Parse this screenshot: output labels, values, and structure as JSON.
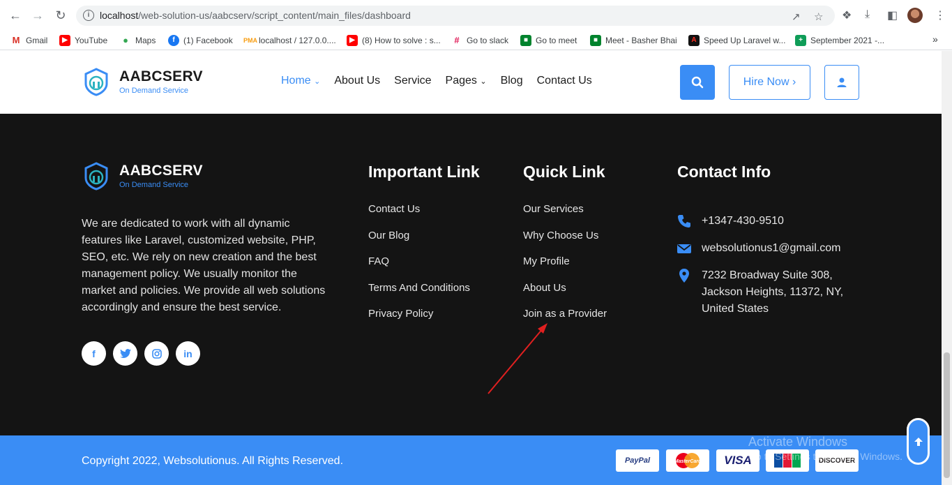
{
  "browser": {
    "url_host": "localhost",
    "url_path": "/web-solution-us/aabcserv/script_content/main_files/dashboard",
    "bookmarks": [
      {
        "label": "Gmail",
        "icon": "gmail-icon"
      },
      {
        "label": "YouTube",
        "icon": "youtube-icon"
      },
      {
        "label": "Maps",
        "icon": "maps-icon"
      },
      {
        "label": "(1) Facebook",
        "icon": "facebook-icon"
      },
      {
        "label": "localhost / 127.0.0....",
        "icon": "phpmyadmin-icon"
      },
      {
        "label": "(8) How to solve : s...",
        "icon": "youtube-icon"
      },
      {
        "label": "Go to slack",
        "icon": "slack-icon"
      },
      {
        "label": "Go to meet",
        "icon": "meet-icon"
      },
      {
        "label": "Meet - Basher Bhai",
        "icon": "meet-icon"
      },
      {
        "label": "Speed Up Laravel w...",
        "icon": "laravel-icon"
      },
      {
        "label": "September 2021 -...",
        "icon": "sheets-icon"
      }
    ],
    "more_bookmarks": "»"
  },
  "header": {
    "brand": "AABCSERV",
    "tagline": "On Demand Service",
    "nav": [
      {
        "label": "Home",
        "dropdown": true,
        "active": true
      },
      {
        "label": "About Us",
        "dropdown": false
      },
      {
        "label": "Service",
        "dropdown": false
      },
      {
        "label": "Pages",
        "dropdown": true
      },
      {
        "label": "Blog",
        "dropdown": false
      },
      {
        "label": "Contact Us",
        "dropdown": false
      }
    ],
    "hire_label": "Hire Now",
    "hire_chevron": "›",
    "accent": "#3a8df5"
  },
  "footer": {
    "brand": "AABCSERV",
    "tagline": "On Demand Service",
    "about": "We are dedicated to work with all dynamic features like Laravel, customized website, PHP, SEO, etc. We rely on new creation and the best management policy. We usually monitor the market and policies. We provide all web solutions accordingly and ensure the best service.",
    "socials": [
      {
        "icon": "facebook-icon",
        "glyph": "f"
      },
      {
        "icon": "twitter-icon",
        "glyph": "t"
      },
      {
        "icon": "instagram-icon",
        "glyph": "◎"
      },
      {
        "icon": "linkedin-icon",
        "glyph": "in"
      }
    ],
    "important_title": "Important Link",
    "important_links": [
      "Contact Us",
      "Our Blog",
      "FAQ",
      "Terms And Conditions",
      "Privacy Policy"
    ],
    "quick_title": "Quick Link",
    "quick_links": [
      "Our Services",
      "Why Choose Us",
      "My Profile",
      "About Us",
      "Join as a Provider"
    ],
    "contact_title": "Contact Info",
    "phone": "+1347-430-9510",
    "email": "websolutionus1@gmail.com",
    "address": "7232 Broadway Suite 308, Jackson Heights, 11372, NY, United States",
    "background": "#141414"
  },
  "bottom": {
    "copyright": "Copyright 2022, Websolutionus. All Rights Reserved.",
    "payments": [
      "PayPal",
      "MasterCard",
      "VISA",
      "JCB",
      "DISCOVER"
    ],
    "watermark_line1": "Activate Windows",
    "watermark_line2": "Go to Settings to activate Windows."
  }
}
